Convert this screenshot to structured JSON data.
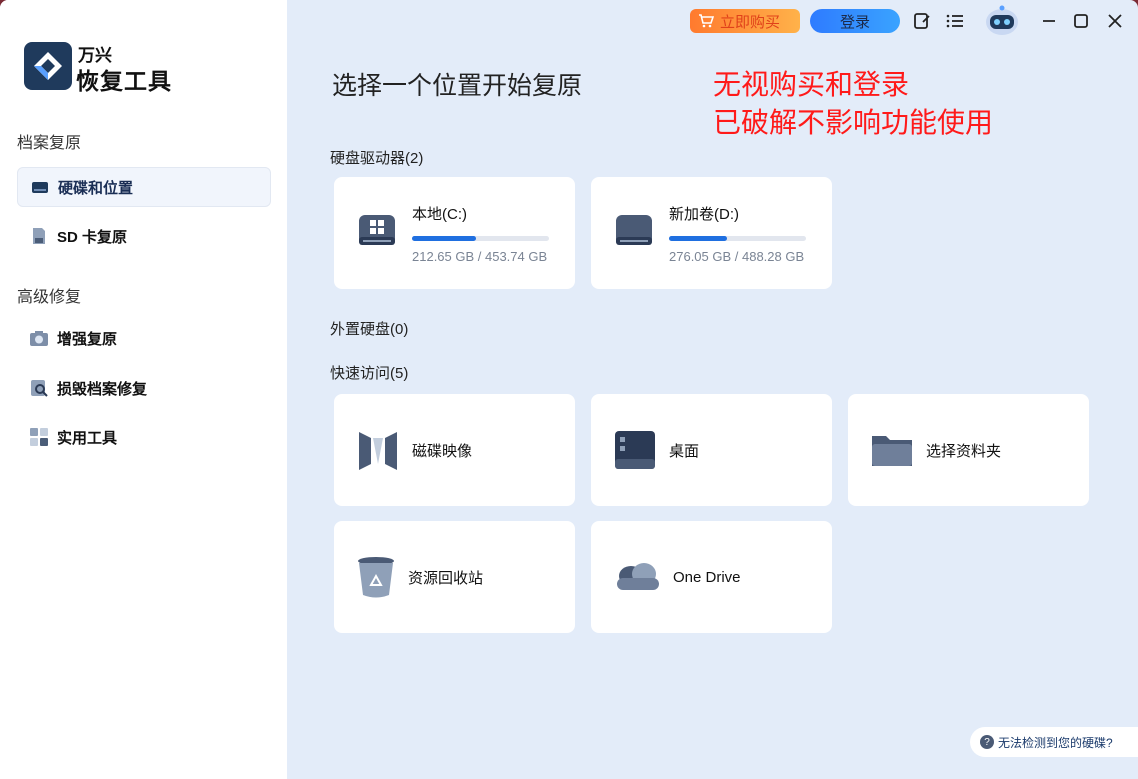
{
  "app": {
    "brand_small": "万兴",
    "brand_large": "恢复工具"
  },
  "titlebar": {
    "buy_label": "立即购买",
    "login_label": "登录"
  },
  "sidebar": {
    "section1": "档案复原",
    "section2": "高级修复",
    "items": [
      {
        "label": "硬碟和位置",
        "icon": "hard-drive-icon",
        "active": true
      },
      {
        "label": "SD 卡复原",
        "icon": "sd-card-icon"
      },
      {
        "label": "增强复原",
        "icon": "camera-icon"
      },
      {
        "label": "损毁档案修复",
        "icon": "repair-file-icon"
      },
      {
        "label": "实用工具",
        "icon": "tools-grid-icon"
      }
    ]
  },
  "main": {
    "title": "选择一个位置开始复原",
    "annotation_line1": "无视购买和登录",
    "annotation_line2": "已破解不影响功能使用",
    "drives_label": "硬盘驱动器(2)",
    "drives": [
      {
        "name": "本地(C:)",
        "size": "212.65 GB / 453.74 GB",
        "used_fraction": 0.47
      },
      {
        "name": "新加卷(D:)",
        "size": "276.05 GB / 488.28 GB",
        "used_fraction": 0.42
      }
    ],
    "external_label": "外置硬盘(0)",
    "quick_label": "快速访问(5)",
    "quick": [
      {
        "name": "磁碟映像",
        "icon": "disk-image-icon"
      },
      {
        "name": "桌面",
        "icon": "desktop-icon"
      },
      {
        "name": "选择资料夹",
        "icon": "folder-icon"
      },
      {
        "name": "资源回收站",
        "icon": "recycle-bin-icon"
      },
      {
        "name": "One Drive",
        "icon": "onedrive-icon"
      }
    ]
  },
  "help": {
    "label": "无法检测到您的硬碟?"
  },
  "colors": {
    "accent": "#1f6fe0",
    "annotation": "#ff1a1a",
    "main_bg": "#e3ecf9"
  }
}
